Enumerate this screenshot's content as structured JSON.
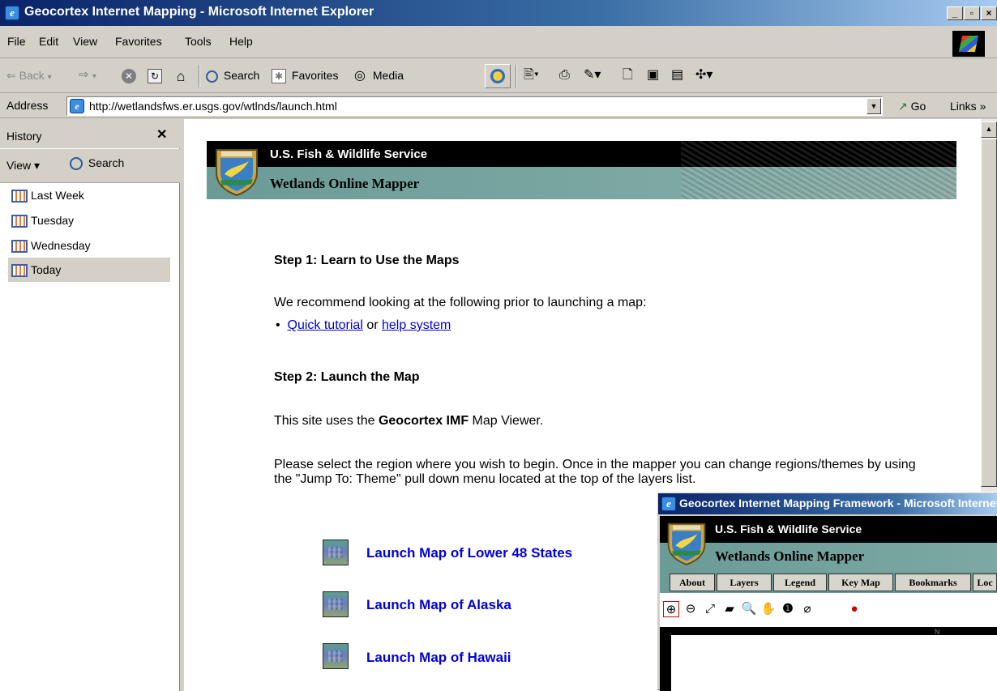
{
  "window": {
    "title": "Geocortex Internet Mapping - Microsoft Internet Explorer",
    "minimize_label": "_",
    "restore_label": "▫",
    "close_label": "×"
  },
  "menu": [
    "File",
    "Edit",
    "View",
    "Favorites",
    "Tools",
    "Help"
  ],
  "toolbar": {
    "back": "Back",
    "search": "Search",
    "favorites": "Favorites",
    "media": "Media"
  },
  "address": {
    "label": "Address",
    "url": "http://wetlandsfws.er.usgs.gov/wtlnds/launch.html",
    "go": "Go",
    "links": "Links »"
  },
  "history": {
    "title": "History",
    "view": "View ▾",
    "search": "Search",
    "items": [
      "Last Week",
      "Tuesday",
      "Wednesday",
      "Today"
    ],
    "selected": "Today"
  },
  "banner": {
    "agency": "U.S. Fish & Wildlife Service",
    "app": "Wetlands Online Mapper"
  },
  "content": {
    "step1_title": "Step 1: Learn to Use the Maps",
    "step1_text": "We recommend looking at the following prior to launching a map:",
    "quick_tutorial": "Quick tutorial",
    "or": " or ",
    "help_system": "help system",
    "step2_title": "Step 2: Launch the Map",
    "viewer_prefix": "This site uses the ",
    "viewer_name": "Geocortex IMF",
    "viewer_suffix": " Map Viewer.",
    "region_text": "Please select the region where you wish to begin. Once in the mapper you can change regions/themes by using the \"Jump To: Theme\" pull down menu located at the top of the layers list.",
    "launch": [
      "Launch Map of Lower 48 States",
      "Launch Map of Alaska",
      "Launch Map of Hawaii"
    ]
  },
  "popup": {
    "title": "Geocortex Internet Mapping Framework - Microsoft Internet Explorer",
    "agency": "U.S. Fish & Wildlife Service",
    "app": "Wetlands Online Mapper",
    "tabs": [
      "About",
      "Layers",
      "Legend",
      "Key Map",
      "Bookmarks",
      "Loc"
    ],
    "north_label": "N"
  },
  "colors": {
    "titlebar_start": "#0a246a",
    "titlebar_end": "#a6caf0",
    "link": "#0000cc",
    "banner_teal": "#6b9b97",
    "chrome": "#d4d0c8"
  }
}
